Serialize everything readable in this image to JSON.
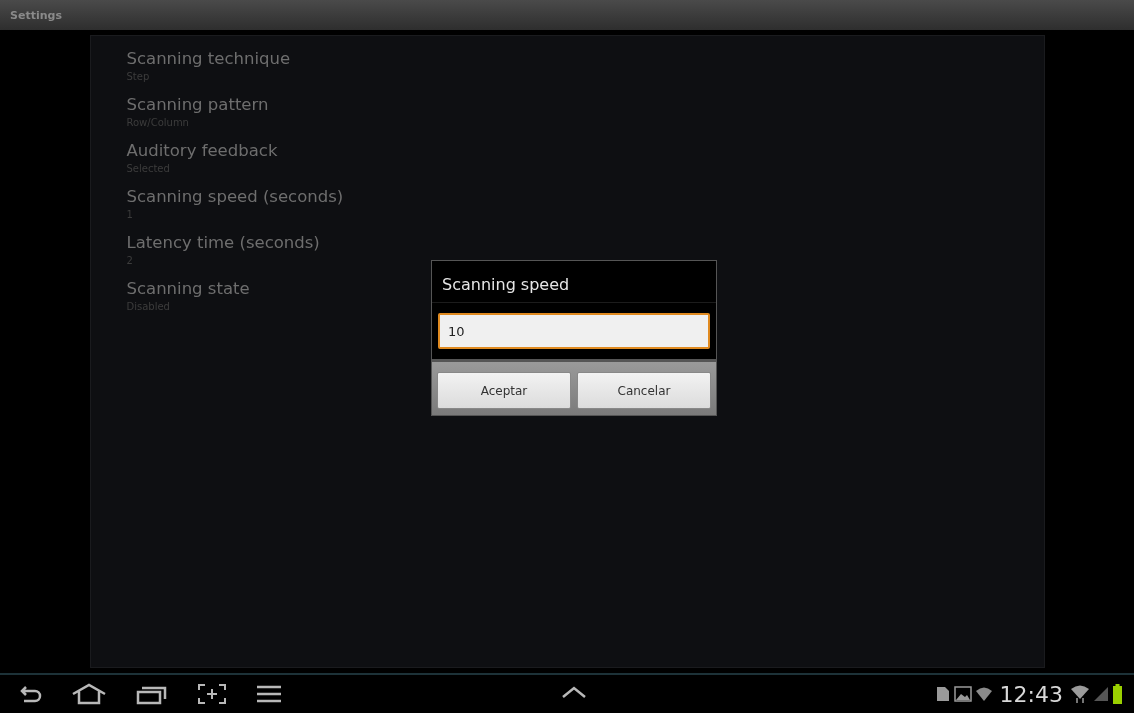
{
  "window": {
    "title": "Settings"
  },
  "preferences": [
    {
      "title": "Scanning technique",
      "summary": "Step"
    },
    {
      "title": "Scanning pattern",
      "summary": "Row/Column"
    },
    {
      "title": "Auditory feedback",
      "summary": "Selected"
    },
    {
      "title": "Scanning speed (seconds)",
      "summary": "1"
    },
    {
      "title": "Latency time (seconds)",
      "summary": "2"
    },
    {
      "title": "Scanning state",
      "summary": "Disabled"
    }
  ],
  "dialog": {
    "title": "Scanning speed",
    "value": "10",
    "buttons": [
      "Aceptar",
      "Cancelar"
    ]
  },
  "status_bar": {
    "time": "12:43"
  }
}
